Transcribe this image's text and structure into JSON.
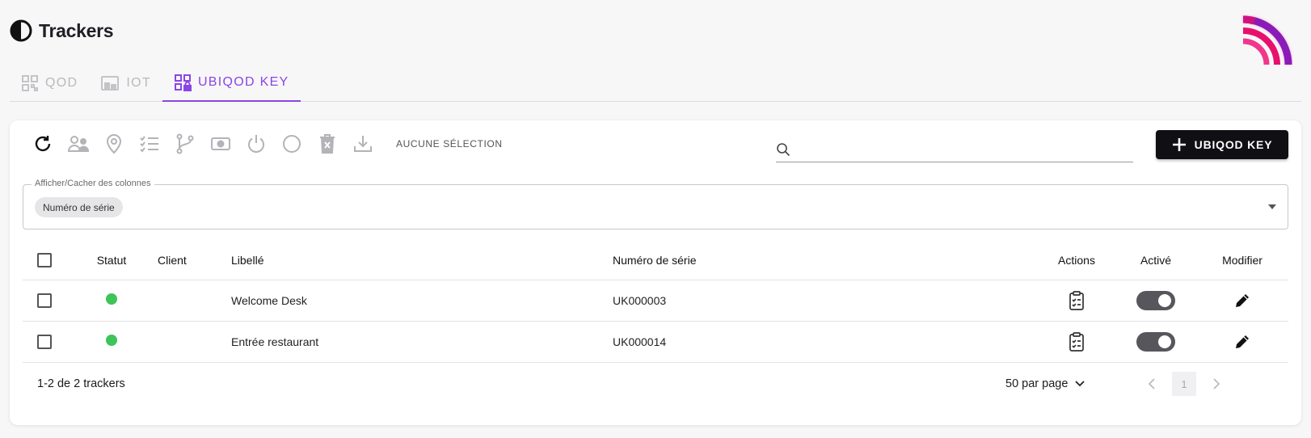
{
  "header": {
    "title": "Trackers",
    "logo_icon": "half-circle-icon"
  },
  "brand": {
    "icon": "signal-arcs-logo",
    "colors": [
      "#e8106d",
      "#7a1fb3"
    ]
  },
  "tabs": [
    {
      "label": "QOD",
      "icon": "qr-code-icon",
      "active": false
    },
    {
      "label": "IOT",
      "icon": "device-icon",
      "active": false
    },
    {
      "label": "UBIQOD KEY",
      "icon": "qr-lock-icon",
      "active": true
    }
  ],
  "toolbar": {
    "tools": [
      "refresh-icon",
      "assign-users-icon",
      "location-icon",
      "checklist-icon",
      "branch-icon",
      "payment-icon",
      "power-icon",
      "circle-icon",
      "delete-icon",
      "download-icon"
    ],
    "selection_label": "AUCUNE SÉLECTION",
    "search_placeholder": "",
    "add_button_label": "UBIQOD KEY"
  },
  "column_picker": {
    "legend": "Afficher/Cacher des colonnes",
    "chips": [
      "Numéro de série"
    ]
  },
  "table": {
    "headers": {
      "status": "Statut",
      "client": "Client",
      "label": "Libellé",
      "serial": "Numéro de série",
      "actions": "Actions",
      "active": "Activé",
      "edit": "Modifier"
    },
    "rows": [
      {
        "status": "active",
        "client": "",
        "label": "Welcome Desk",
        "serial": "UK000003",
        "enabled": true
      },
      {
        "status": "active",
        "client": "",
        "label": "Entrée restaurant",
        "serial": "UK000014",
        "enabled": true
      }
    ]
  },
  "footer": {
    "count_text": "1-2 de 2 trackers",
    "per_page_label": "50 par page",
    "current_page": "1"
  },
  "colors": {
    "accent": "#8a45e6",
    "status_ok": "#3ec459",
    "button_dark": "#0f0f14",
    "toggle_on": "#56565c"
  }
}
